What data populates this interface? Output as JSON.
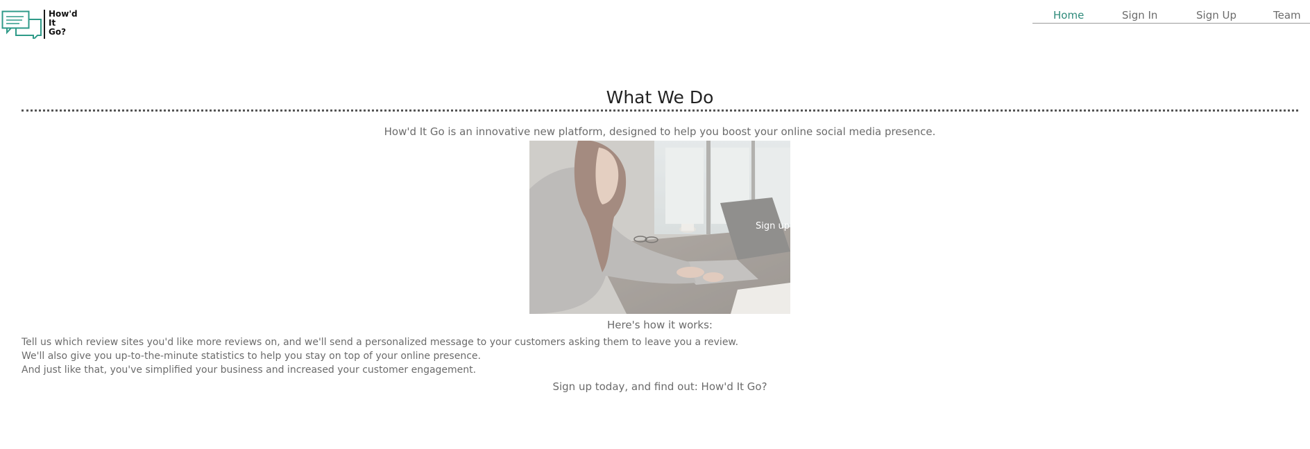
{
  "logo": {
    "icon": "speech-bubbles-icon",
    "lines": [
      "How'd",
      "It",
      "Go?"
    ],
    "accent_color": "#2e9a88"
  },
  "nav": {
    "items": [
      {
        "label": "Home",
        "active": true
      },
      {
        "label": "Sign In",
        "active": false
      },
      {
        "label": "Sign Up",
        "active": false
      },
      {
        "label": "Team",
        "active": false
      }
    ],
    "active_color": "#2e8a7a"
  },
  "main": {
    "title": "What We Do",
    "intro": "How'd It Go is an innovative new platform, designed to help you boost your online social media presence.",
    "hero": {
      "cta_label": "Sign up"
    },
    "how_heading": "Here's how it works:",
    "steps": [
      "Tell us which review sites you'd like more reviews on, and we'll send a personalized message to your customers asking them to leave you a review.",
      "We'll also give you up-to-the-minute statistics to help you stay on top of your online presence.",
      "And just like that, you've simplified your business and increased your customer engagement."
    ],
    "closing": "Sign up today, and find out: How'd It Go?"
  }
}
